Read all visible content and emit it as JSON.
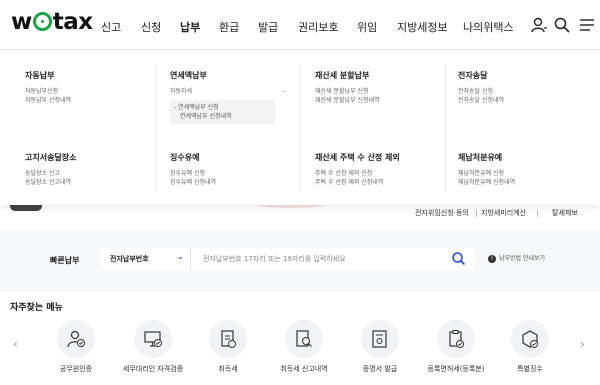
{
  "header": {
    "logo": "wetax",
    "logo_prefix": "w",
    "logo_suffix": "tax",
    "nav": [
      "신고",
      "신청",
      "납부",
      "환급",
      "발급",
      "권리보호",
      "위임",
      "지방세정보",
      "나의위택스"
    ],
    "active_nav": "납부"
  },
  "dropdown": {
    "columns": [
      {
        "title": "자동납부",
        "items": [
          "자동납부신청",
          "자동납부 신청내역"
        ]
      },
      {
        "title": "연세액납부",
        "items": [
          "자동차세"
        ],
        "sub_items": [
          "연세액납부 신청",
          "연세액납부 신청내역"
        ],
        "toggle": "–"
      },
      {
        "title": "재산세 분할납부",
        "items": [
          "재산세 분할납부 신청",
          "재산세 분할납부 신청내역"
        ]
      },
      {
        "title": "전자송달",
        "items": [
          "전자송달 신청",
          "전자송달 신청내역"
        ]
      },
      {
        "title": "고지서송달장소",
        "items": [
          "송달장소 신고",
          "송달장소 신고내역"
        ]
      },
      {
        "title": "징수유예",
        "items": [
          "징수유예 신청",
          "징수유예 신청내역"
        ]
      },
      {
        "title": "재산세 주택 수 산정 제외",
        "items": [
          "주택 수 산정 제외 신청",
          "주택 수 산정 제외 신청내역"
        ]
      },
      {
        "title": "체납처분유예",
        "items": [
          "체납처분유예 신청",
          "체납처분유예 신청내역"
        ]
      }
    ]
  },
  "utility_links": [
    "전자위임신청·동의",
    "지방세미리계산",
    "탈세제보"
  ],
  "quick_pay": {
    "label": "빠른납부",
    "select_value": "전자납부번호",
    "placeholder": "전자납부번호 17자리 또는 19자리를 입력하세요",
    "help": "납부방법 안내보기"
  },
  "frequent": {
    "title": "자주찾는 메뉴",
    "items": [
      {
        "label": "공무원인증",
        "icon": "person-check-icon"
      },
      {
        "label": "세무대리인 자격검증",
        "icon": "monitor-check-icon"
      },
      {
        "label": "취득세",
        "icon": "document-icon"
      },
      {
        "label": "취득세 신고내역",
        "icon": "document-search-icon"
      },
      {
        "label": "증명서 발급",
        "icon": "certificate-icon"
      },
      {
        "label": "등록면허세(등록분)",
        "icon": "clipboard-check-icon"
      },
      {
        "label": "특별징수",
        "icon": "box-check-icon"
      }
    ]
  },
  "colors": {
    "highlight": "#e01c1c",
    "logo_accent": "#1aa34a",
    "accent": "#1a4ad4"
  }
}
